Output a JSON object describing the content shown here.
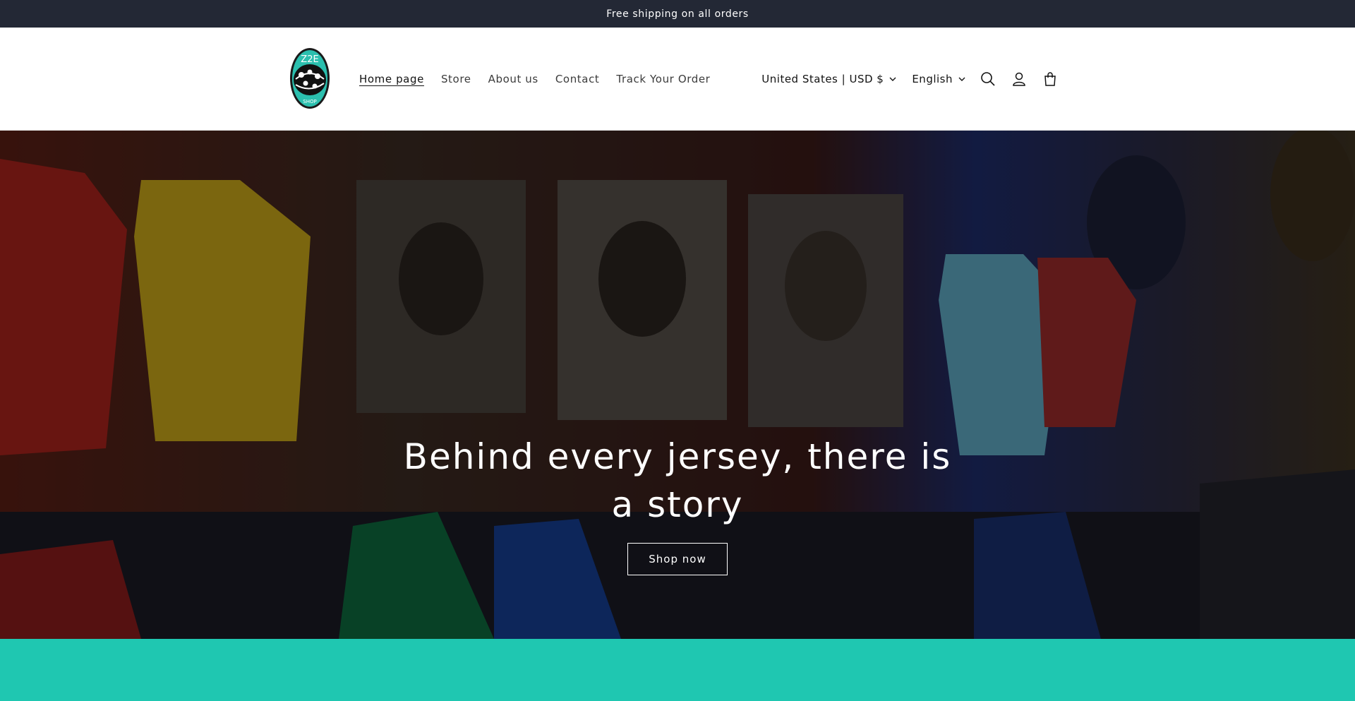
{
  "announcement": {
    "text": "Free shipping on all orders"
  },
  "header": {
    "logo_alt": "Z2E store logo",
    "nav": [
      {
        "label": "Home page",
        "active": true
      },
      {
        "label": "Store"
      },
      {
        "label": "About us"
      },
      {
        "label": "Contact"
      },
      {
        "label": "Track Your Order"
      }
    ],
    "country_selector": "United States | USD $",
    "language_selector": "English",
    "icons": [
      "search-icon",
      "account-icon",
      "cart-icon"
    ]
  },
  "hero": {
    "title": "Behind every jersey, there is a story",
    "button_label": "Shop now"
  },
  "colors": {
    "announcement_bg": "#232835",
    "accent_teal": "#1fc7b1",
    "header_bg": "#ffffff"
  }
}
